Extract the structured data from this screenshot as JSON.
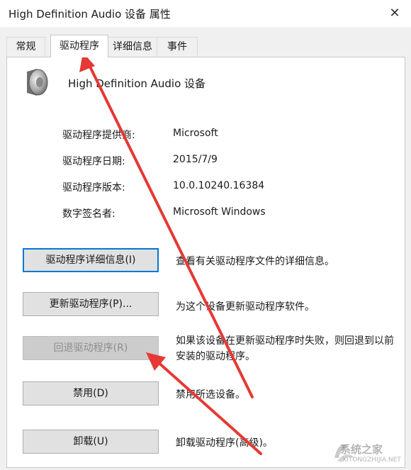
{
  "window": {
    "title": "High Definition Audio 设备 属性",
    "close_label": "✕"
  },
  "tabs": [
    {
      "label": "常规",
      "active": false
    },
    {
      "label": "驱动程序",
      "active": true
    },
    {
      "label": "详细信息",
      "active": false
    },
    {
      "label": "事件",
      "active": false
    }
  ],
  "device": {
    "name": "High Definition Audio 设备",
    "icon": "speaker-icon"
  },
  "info": [
    {
      "label": "驱动程序提供商:",
      "value": "Microsoft"
    },
    {
      "label": "驱动程序日期:",
      "value": "2015/7/9"
    },
    {
      "label": "驱动程序版本:",
      "value": "10.0.10240.16384"
    },
    {
      "label": "数字签名者:",
      "value": "Microsoft Windows"
    }
  ],
  "actions": [
    {
      "button": "驱动程序详细信息(I)",
      "desc": "查看有关驱动程序文件的详细信息。",
      "enabled": true
    },
    {
      "button": "更新驱动程序(P)...",
      "desc": "为这个设备更新驱动程序软件。",
      "enabled": true
    },
    {
      "button": "回退驱动程序(R)",
      "desc": "如果该设备在更新驱动程序时失败，则回退到以前安装的驱动程序。",
      "enabled": false
    },
    {
      "button": "禁用(D)",
      "desc": "禁用所选设备。",
      "enabled": true
    },
    {
      "button": "卸载(U)",
      "desc": "卸载驱动程序(高级)。",
      "enabled": true
    }
  ],
  "annotation_color": "#e53935",
  "watermark": {
    "text": "系统之家",
    "url": "XITONGZHIJIA.NET"
  }
}
